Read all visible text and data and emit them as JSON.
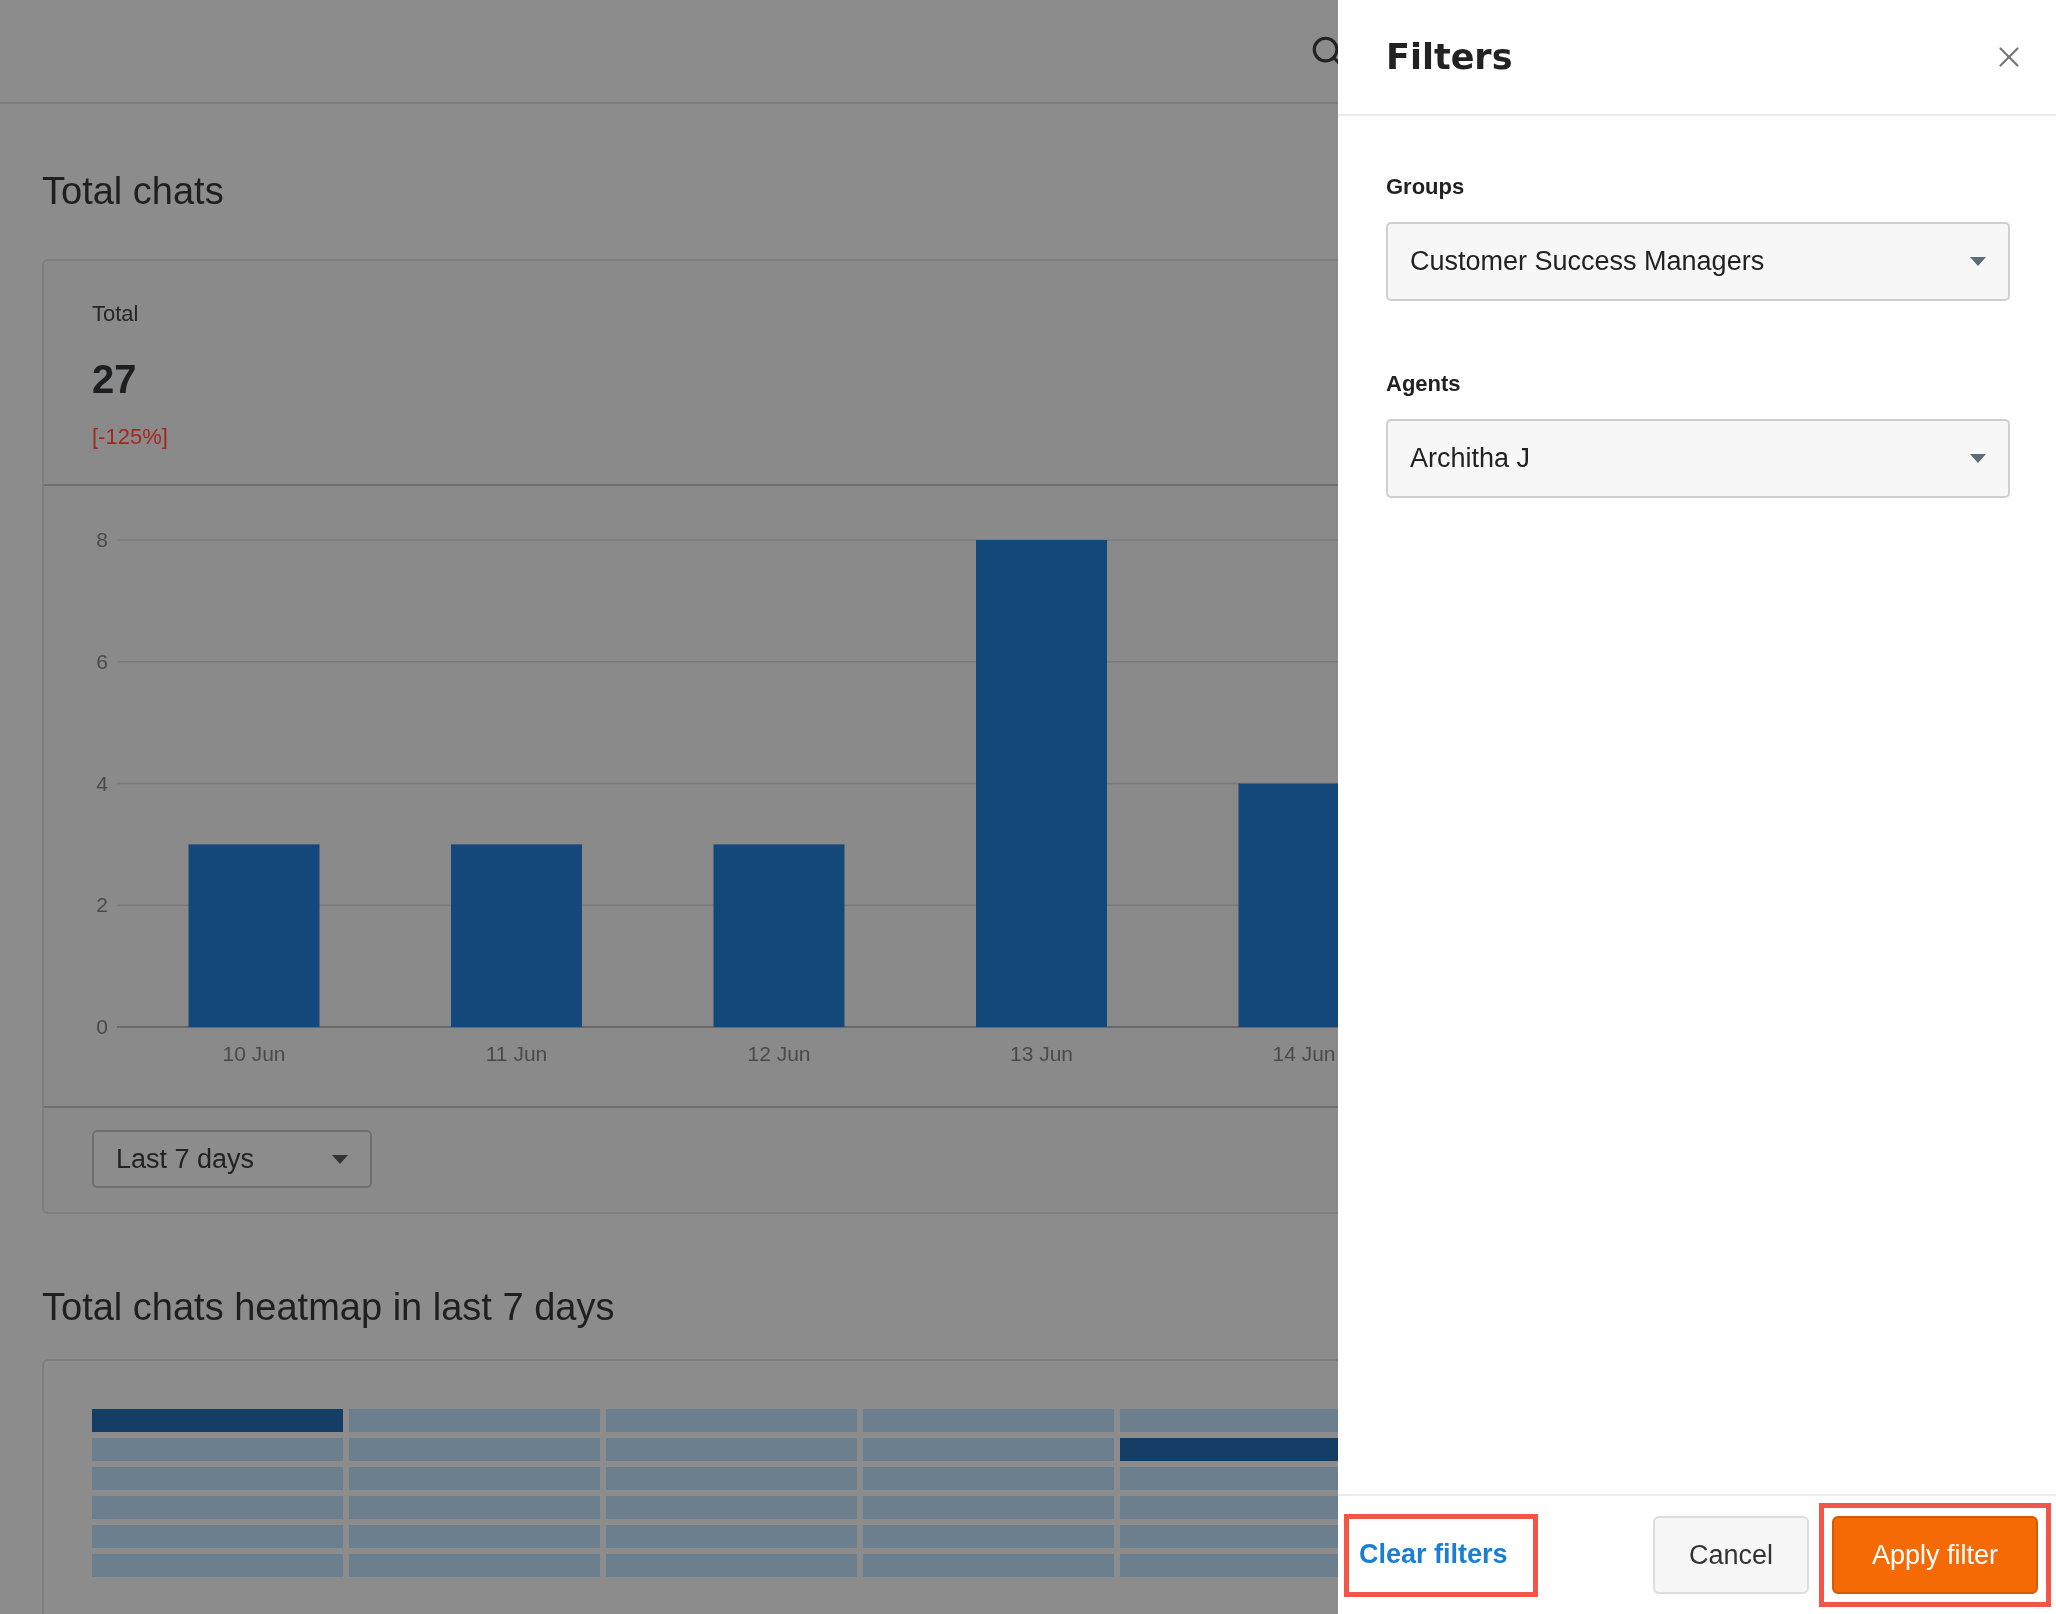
{
  "page": {
    "section_title": "Total chats",
    "summary": {
      "label": "Total",
      "value": "27",
      "change": "[-125%]"
    },
    "chart_data": {
      "type": "bar",
      "categories": [
        "10 Jun",
        "11 Jun",
        "12 Jun",
        "13 Jun",
        "14 Jun"
      ],
      "values": [
        3,
        3,
        3,
        8,
        4
      ],
      "grid": true,
      "ylim": [
        0,
        8
      ],
      "yticks": [
        0,
        2,
        4,
        6,
        8
      ]
    },
    "range_select": {
      "value": "Last 7 days"
    },
    "heatmap": {
      "title": "Total chats heatmap in last 7 days",
      "rows": [
        [
          {
            "kind": "high"
          },
          {
            "kind": "low"
          },
          {
            "kind": "low"
          },
          {
            "kind": "low"
          },
          {
            "kind": "low"
          }
        ],
        [
          {
            "kind": "low"
          },
          {
            "kind": "low"
          },
          {
            "kind": "low"
          },
          {
            "kind": "low"
          },
          {
            "kind": "high"
          }
        ],
        [
          {
            "kind": "low"
          },
          {
            "kind": "low"
          },
          {
            "kind": "low"
          },
          {
            "kind": "low"
          },
          {
            "kind": "low"
          }
        ],
        [
          {
            "kind": "low"
          },
          {
            "kind": "low"
          },
          {
            "kind": "low"
          },
          {
            "kind": "low"
          },
          {
            "kind": "low"
          }
        ],
        [
          {
            "kind": "low"
          },
          {
            "kind": "low"
          },
          {
            "kind": "low"
          },
          {
            "kind": "low"
          },
          {
            "kind": "low"
          }
        ],
        [
          {
            "kind": "low"
          },
          {
            "kind": "low"
          },
          {
            "kind": "low"
          },
          {
            "kind": "low"
          },
          {
            "kind": "low"
          }
        ]
      ]
    }
  },
  "filters": {
    "title": "Filters",
    "fields": [
      {
        "label": "Groups",
        "value": "Customer Success Managers"
      },
      {
        "label": "Agents",
        "value": "Architha J"
      }
    ],
    "clear_label": "Clear filters",
    "cancel_label": "Cancel",
    "apply_label": "Apply filter"
  }
}
